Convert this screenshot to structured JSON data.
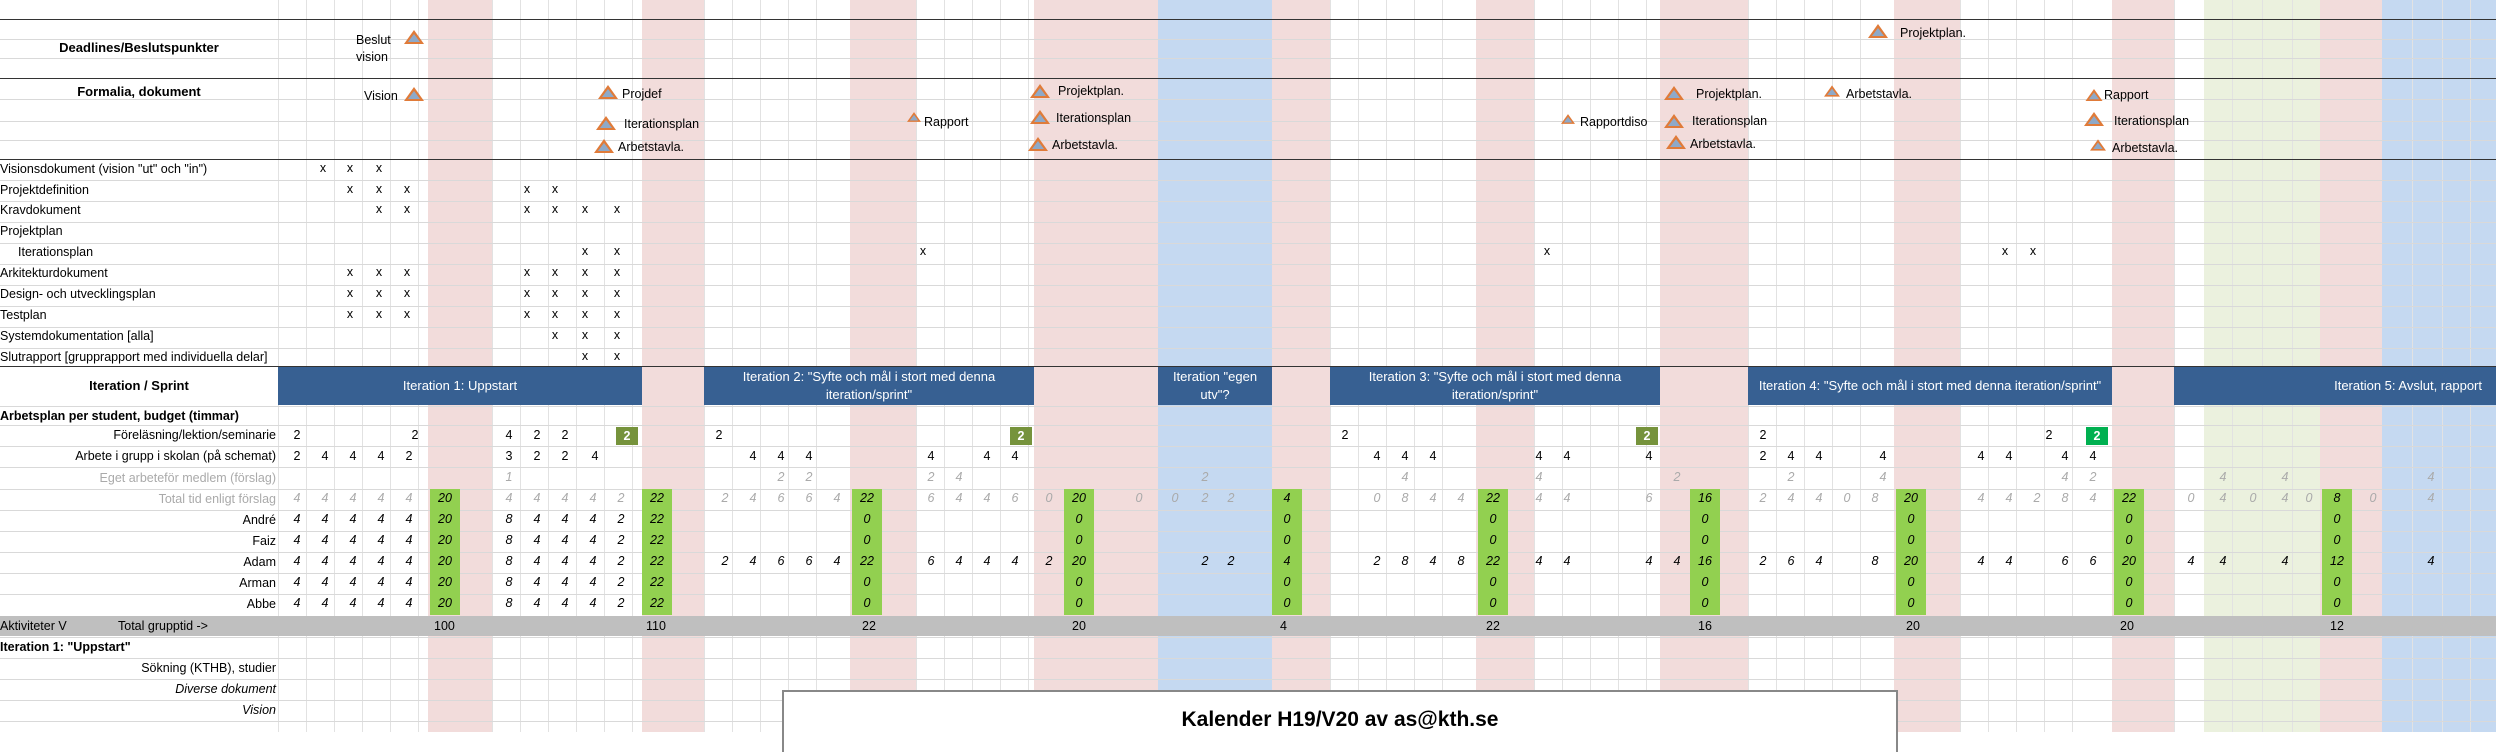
{
  "headers": {
    "deadlines": "Deadlines/Beslutspunkter",
    "formalia": "Formalia, dokument",
    "iteration_sprint": "Iteration / Sprint",
    "arbetsplan": "Arbetsplan per student, budget (timmar)",
    "aktiviteter": "Aktiviteter V",
    "total_grupptid": "Total grupptid ->",
    "iteration1_section": "Iteration 1: \"Uppstart\""
  },
  "deadline_markers": [
    {
      "label": "Beslut vision"
    },
    {
      "label": "Projektplan."
    }
  ],
  "formalia_markers": [
    {
      "label": "Vision"
    },
    {
      "label": "Projdef"
    },
    {
      "label": "Iterationsplan"
    },
    {
      "label": "Arbetstavla."
    },
    {
      "label": "Rapport"
    },
    {
      "label": "Projektplan."
    },
    {
      "label": "Iterationsplan"
    },
    {
      "label": "Arbetstavla."
    },
    {
      "label": "Rapportdiso"
    },
    {
      "label": "Projektplan."
    },
    {
      "label": "Iterationsplan"
    },
    {
      "label": "Arbetstavla."
    },
    {
      "label": "Arbetstavla."
    },
    {
      "label": "Rapport"
    },
    {
      "label": "Iterationsplan"
    },
    {
      "label": "Arbetstavla."
    }
  ],
  "doc_rows": [
    "Visionsdokument (vision \"ut\" och \"in\")",
    "Projektdefinition",
    "Kravdokument",
    "Projektplan",
    "Iterationsplan",
    "Arkitekturdokument",
    "Design- och utvecklingsplan",
    "Testplan",
    "Systemdokumentation [alla]",
    "Slutrapport [grupprapport med individuella delar]"
  ],
  "doc_mark": "x",
  "iterations": [
    "Iteration 1: Uppstart",
    "Iteration 2: \"Syfte och mål i stort med denna iteration/sprint\"",
    "Iteration \"egen utv\"?",
    "Iteration 3: \"Syfte och mål i stort med denna iteration/sprint\"",
    "Iteration 4: \"Syfte och mål i stort med denna iteration/sprint\"",
    "Iteration 5: Avslut, rapport"
  ],
  "plan_rows": {
    "forelasning": "Föreläsning/lektion/seminarie",
    "arbete_grupp": "Arbete i grupp i skolan (på schemat)",
    "eget_arbete": "Eget arbeteför medlem (förslag)",
    "total_forslag": "Total tid enligt förslag"
  },
  "members": [
    "André",
    "Faiz",
    "Adam",
    "Arman",
    "Abbe"
  ],
  "totals": [
    "100",
    "110",
    "22",
    "20",
    "4",
    "22",
    "16",
    "20",
    "20",
    "12"
  ],
  "section_rows": [
    "Sökning (KTHB), studier",
    "Diverse dokument",
    "Vision"
  ],
  "calendar_title": "Kalender H19/V20 av as@kth.se",
  "colors": {
    "iteration_bar": "#376092",
    "pink_band": "#f2dcdb",
    "blue_band": "#c5d9f1",
    "green_band": "#ebf1de",
    "green_cell": "#92d050",
    "olive_cell": "#76933c",
    "bright_green_cell": "#00b050",
    "marker": "#e07b39"
  }
}
